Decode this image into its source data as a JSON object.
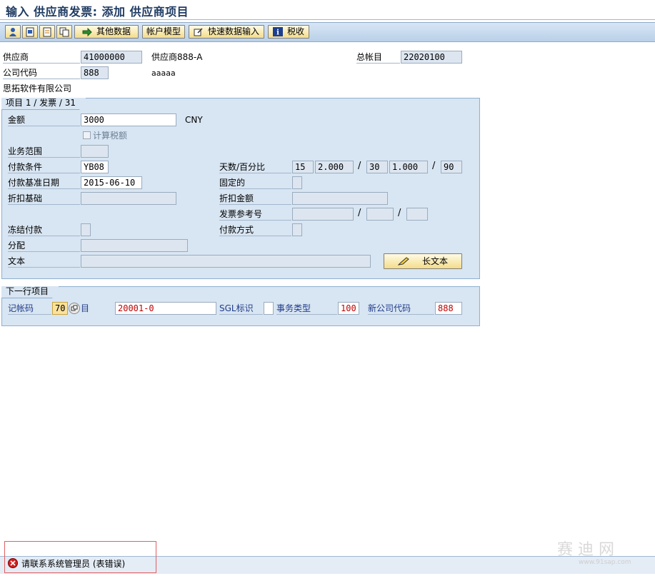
{
  "window": {
    "title": "输入 供应商发票: 添加 供应商项目"
  },
  "toolbar": {
    "icon_buttons": [
      "person-icon",
      "overview-icon",
      "document-icon",
      "copy-icon"
    ],
    "more_data": "其他数据",
    "account_model": "帐户模型",
    "fast_entry": "快速数据输入",
    "tax": "税收"
  },
  "header": {
    "vendor_label": "供应商",
    "vendor_value": "41000000",
    "vendor_name": "供应商888-A",
    "gl_label": "总帐目",
    "gl_value": "22020100",
    "company_code_label": "公司代码",
    "company_code_value": "888",
    "company_code_desc": "aaaaa",
    "company_name": "思拓软件有限公司"
  },
  "item_group": {
    "tab": "项目 1 / 发票 / 31",
    "amount_label": "金额",
    "amount_value": "3000",
    "currency": "CNY",
    "calc_tax_label": "计算税额",
    "business_area_label": "业务范围",
    "business_area_value": "",
    "payment_terms_label": "付款条件",
    "payment_terms_value": "YB08",
    "days_pct_label": "天数/百分比",
    "days1": "15",
    "pct1": "2.000",
    "days2": "30",
    "pct2": "1.000",
    "days3": "90",
    "slash": "/",
    "baseline_label": "付款基准日期",
    "baseline_value": "2015-06-10",
    "fixed_label": "固定的",
    "discount_base_label": "折扣基础",
    "discount_amount_label": "折扣金额",
    "invoice_ref_label": "发票参考号",
    "block_label": "冻结付款",
    "payment_method_label": "付款方式",
    "assignment_label": "分配",
    "text_label": "文本",
    "long_text_button": "长文本"
  },
  "next_item": {
    "tab": "下一行项目",
    "posting_key_label": "记帐码",
    "posting_key_value": "70",
    "account_label_suffix": "目",
    "account_value": "20001-0",
    "sgl_label": "SGL标识",
    "trans_type_label": "事务类型",
    "trans_type_value": "100",
    "new_company_label": "新公司代码",
    "new_company_value": "888"
  },
  "status": {
    "message": "请联系系统管理员 (表错误)",
    "watermark": "赛 迪 网",
    "watermark_url": "www.91sap.com"
  },
  "colors": {
    "accent_red": "#c00000",
    "label_blue": "#1f3b8a",
    "group_bg": "#d8e5f2"
  }
}
